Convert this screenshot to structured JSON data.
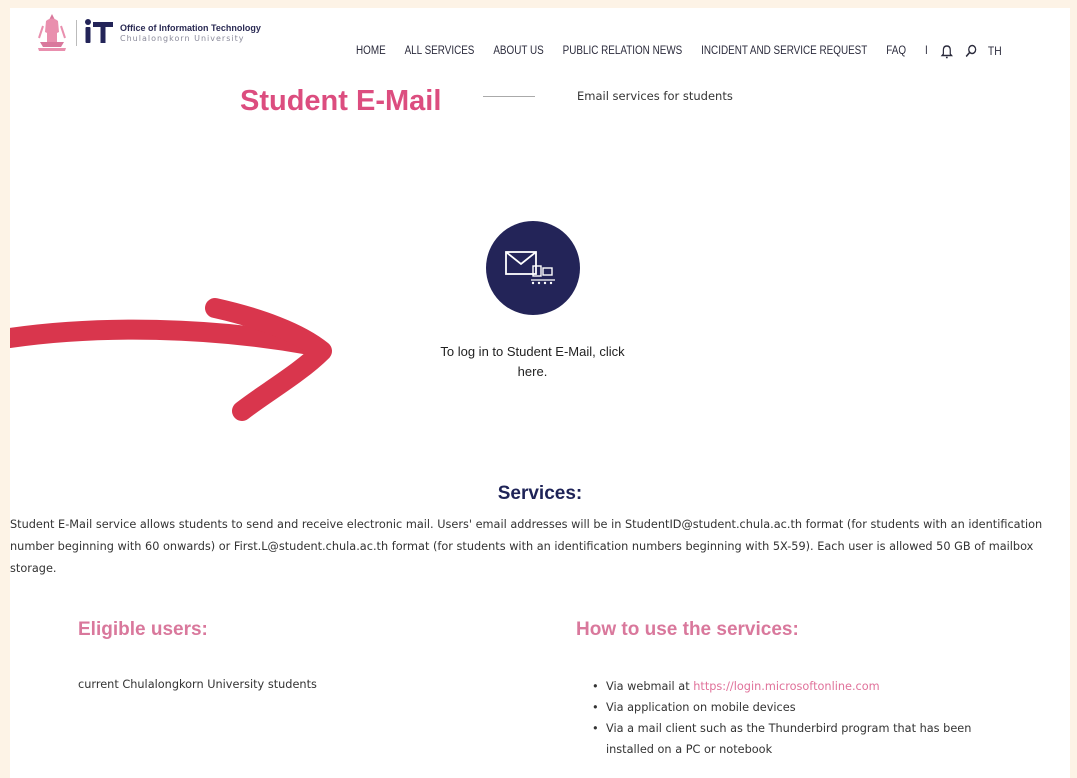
{
  "header": {
    "org_line1": "Office of Information Technology",
    "org_line2": "Chulalongkorn University",
    "nav": [
      "HOME",
      "ALL SERVICES",
      "ABOUT US",
      "PUBLIC RELATION NEWS",
      "INCIDENT AND SERVICE REQUEST",
      "FAQ"
    ],
    "separator": "I",
    "lang": "TH",
    "icons": [
      "bell-icon",
      "search-icon"
    ]
  },
  "title": {
    "heading": "Student E-Mail",
    "subtitle": "Email services for students"
  },
  "login": {
    "text_before": "To log in to Student E-Mail, click",
    "link": "here",
    "text_after": "."
  },
  "services": {
    "title": "Services:",
    "description": "Student E-Mail service allows students to send and receive electronic mail. Users' email addresses will be in StudentID@student.chula.ac.th format (for students with an identification number beginning with 60 onwards) or First.L@student.chula.ac.th format (for students with an identification numbers beginning with 5X-59). Each user is allowed 50 GB of mailbox storage."
  },
  "eligible": {
    "title": "Eligible users:",
    "text": "current Chulalongkorn University students"
  },
  "howto": {
    "title": "How to use the services:",
    "item1_prefix": "Via webmail at",
    "item1_link": "https://login.microsoftonline.com",
    "item2": "Via application on mobile devices",
    "item3": "Via a mail client such as the Thunderbird program that has been installed on a PC or notebook"
  },
  "colors": {
    "page_bg": "#fdf3e6",
    "title_pink": "#dc4d7f",
    "section_pink": "#d9789c",
    "navy": "#232458",
    "arrow_red": "#d9364d",
    "link_pink": "#e0719a"
  }
}
